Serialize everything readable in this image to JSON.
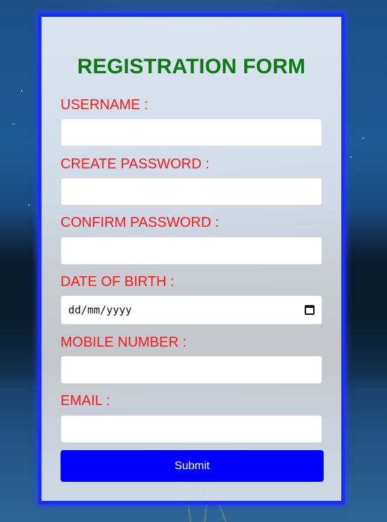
{
  "form": {
    "title": "REGISTRATION FORM",
    "fields": [
      {
        "label": "USERNAME :",
        "value": ""
      },
      {
        "label": "CREATE PASSWORD :",
        "value": ""
      },
      {
        "label": "CONFIRM PASSWORD :",
        "value": ""
      },
      {
        "label": "DATE OF BIRTH :",
        "value": "dd/mm/yyyy"
      },
      {
        "label": "MOBILE NUMBER :",
        "value": ""
      },
      {
        "label": "EMAIL :",
        "value": ""
      }
    ],
    "submit_label": "Submit"
  },
  "colors": {
    "title": "#0a7a12",
    "labels": "#ff1a1a",
    "submit_bg": "#0000ff",
    "panel_border": "#1a2cff"
  },
  "icons": [
    "calendar-icon"
  ]
}
